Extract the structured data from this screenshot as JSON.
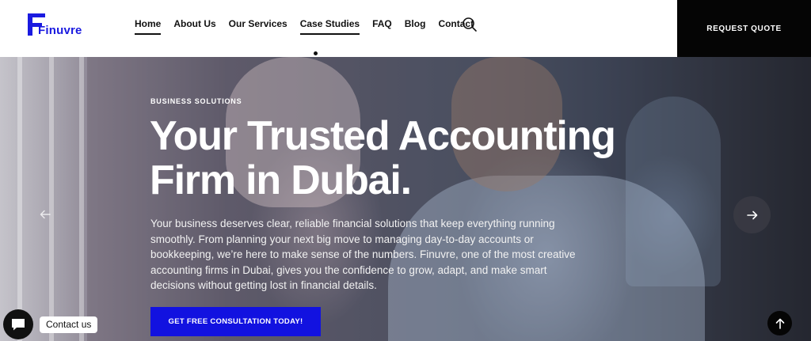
{
  "brand": {
    "name": "Finuvre",
    "accent": "#1a1ae0"
  },
  "nav": {
    "items": [
      {
        "label": "Home"
      },
      {
        "label": "About Us"
      },
      {
        "label": "Our Services"
      },
      {
        "label": "Case Studies"
      },
      {
        "label": "FAQ"
      },
      {
        "label": "Blog"
      },
      {
        "label": "Contact"
      }
    ],
    "search_icon": "search-icon"
  },
  "header": {
    "cta_label": "REQUEST QUOTE"
  },
  "hero": {
    "eyebrow": "BUSINESS SOLUTIONS",
    "headline_line1": "Your Trusted Accounting",
    "headline_line2": "Firm in Dubai.",
    "body": "Your business deserves clear, reliable financial solutions that keep everything running smoothly. From planning your next big move to managing day-to-day accounts or bookkeeping, we’re here to make sense of the numbers. Finuvre, one of the most creative accounting firms in Dubai, gives you the confidence to grow, adapt, and make smart decisions without getting lost in financial details.",
    "cta_label": "GET FREE CONSULTATION TODAY!",
    "cta_color": "#1212e0",
    "prev_icon": "arrow-left-icon",
    "next_icon": "arrow-right-icon"
  },
  "widgets": {
    "chat_label": "Contact us",
    "chat_icon": "chat-icon",
    "to_top_icon": "arrow-up-icon"
  }
}
